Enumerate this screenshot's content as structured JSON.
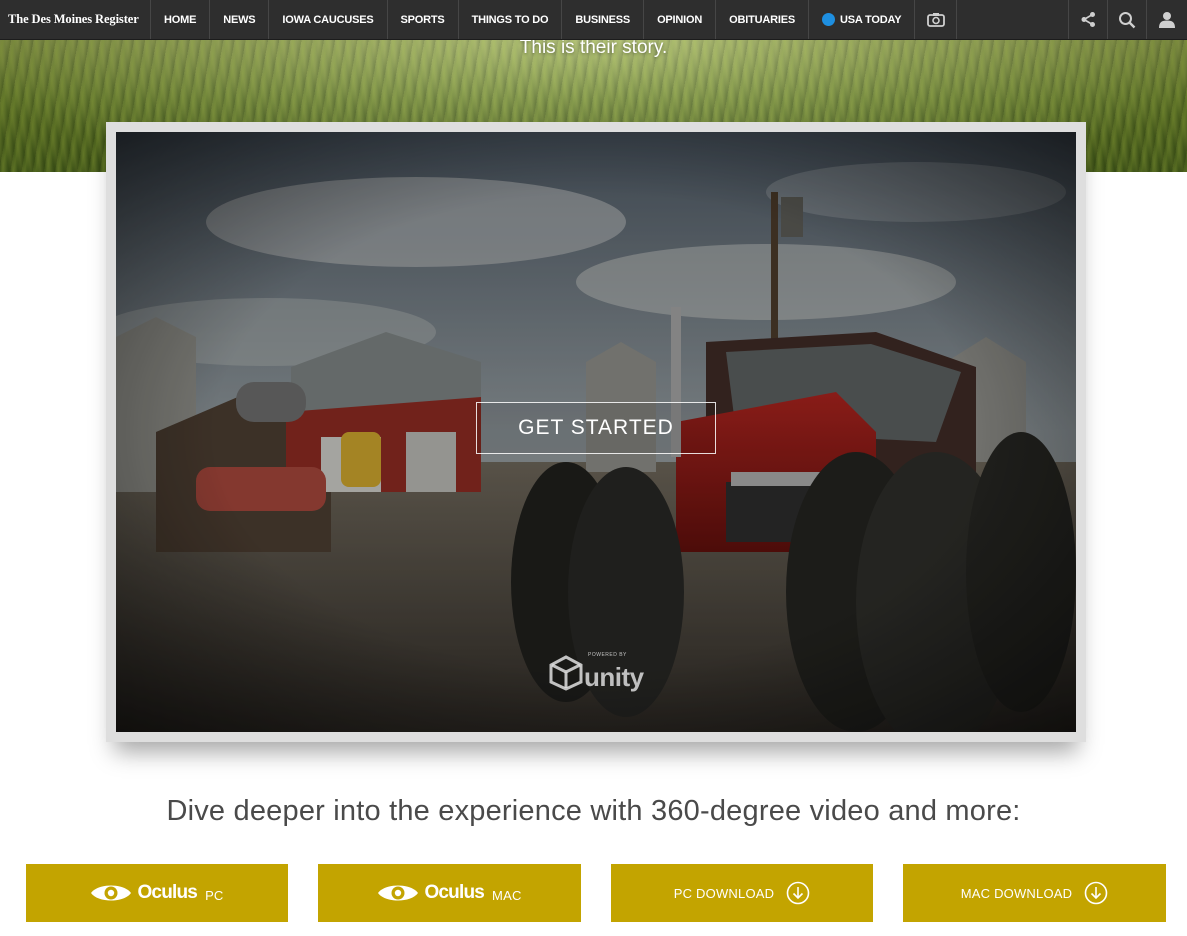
{
  "nav": {
    "brand": "The Des Moines Register",
    "items": [
      {
        "label": "HOME"
      },
      {
        "label": "NEWS"
      },
      {
        "label": "IOWA CAUCUSES"
      },
      {
        "label": "SPORTS"
      },
      {
        "label": "THINGS TO DO"
      },
      {
        "label": "BUSINESS"
      },
      {
        "label": "OPINION"
      },
      {
        "label": "OBITUARIES"
      },
      {
        "label": "USA TODAY"
      }
    ],
    "icons": [
      "camera-icon",
      "share-icon",
      "search-icon",
      "user-icon"
    ]
  },
  "hero": {
    "tagline": "This is their story."
  },
  "game": {
    "start_label": "GET STARTED",
    "engine_powered_by": "POWERED BY",
    "engine_name": "unity"
  },
  "dive": {
    "heading": "Dive deeper into the experience with 360-degree video and more:",
    "buttons": [
      {
        "brand": "Oculus",
        "platform": "PC",
        "icon": "eye-icon"
      },
      {
        "brand": "Oculus",
        "platform": "MAC",
        "icon": "eye-icon"
      },
      {
        "label": "PC DOWNLOAD",
        "icon": "download-icon"
      },
      {
        "label": "MAC DOWNLOAD",
        "icon": "download-icon"
      }
    ]
  },
  "colors": {
    "nav_bg": "#2e2e2e",
    "usa_today_dot": "#1e8fe0",
    "button_gold": "#c3a400",
    "heading_gray": "#4a4a4a"
  }
}
